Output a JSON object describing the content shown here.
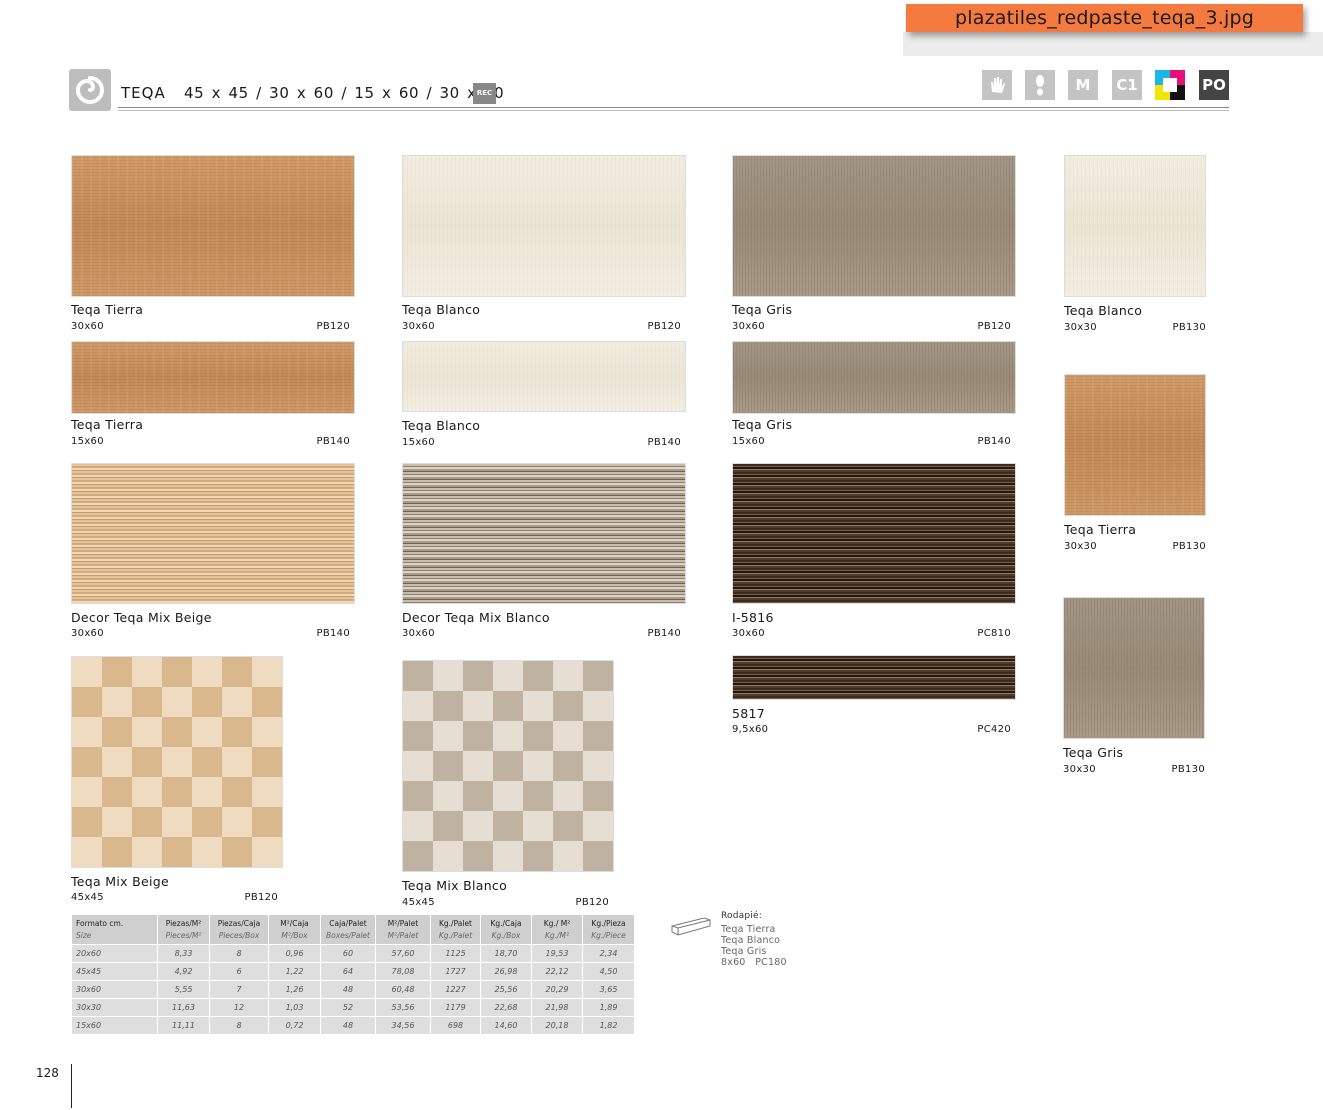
{
  "banner": {
    "filename": "plazatiles_redpaste_teqa_3.jpg"
  },
  "header": {
    "series": "TEQA",
    "formats": "45 x 45 / 30 x 60 / 15 x 60 / 30 x 30",
    "rec_badge": "REC",
    "icons": [
      {
        "name": "hand-icon",
        "label": ""
      },
      {
        "name": "foot-icon",
        "label": ""
      },
      {
        "name": "m-icon",
        "label": "M"
      },
      {
        "name": "c1-icon",
        "label": "C1"
      },
      {
        "name": "color-range-icon",
        "label": ""
      },
      {
        "name": "po-icon",
        "label": "PO"
      }
    ]
  },
  "products": [
    {
      "title": "Teqa Tierra",
      "size": "30x60",
      "code": "PB120"
    },
    {
      "title": "Teqa Blanco",
      "size": "30x60",
      "code": "PB120"
    },
    {
      "title": "Teqa Gris",
      "size": "30x60",
      "code": "PB120"
    },
    {
      "title": "Teqa Blanco",
      "size": "30x30",
      "code": "PB130"
    },
    {
      "title": "Teqa Tierra",
      "size": "15x60",
      "code": "PB140"
    },
    {
      "title": "Teqa Blanco",
      "size": "15x60",
      "code": "PB140"
    },
    {
      "title": "Teqa Gris",
      "size": "15x60",
      "code": "PB140"
    },
    {
      "title": "Teqa Tierra",
      "size": "30x30",
      "code": "PB130"
    },
    {
      "title": "Decor Teqa Mix Beige",
      "size": "30x60",
      "code": "PB140"
    },
    {
      "title": "Decor Teqa Mix Blanco",
      "size": "30x60",
      "code": "PB140"
    },
    {
      "title": "I-5816",
      "size": "30x60",
      "code": "PC810"
    },
    {
      "title": "Teqa Gris",
      "size": "30x30",
      "code": "PB130"
    },
    {
      "title": "Teqa Mix Beige",
      "size": "45x45",
      "code": "PB120"
    },
    {
      "title": "Teqa Mix Blanco",
      "size": "45x45",
      "code": "PB120"
    },
    {
      "title": "5817",
      "size": "9,5x60",
      "code": "PC420"
    }
  ],
  "table": {
    "headers": [
      {
        "es": "Formato cm.",
        "en": "Size"
      },
      {
        "es": "Piezas/M²",
        "en": "Pieces/M²"
      },
      {
        "es": "Piezas/Caja",
        "en": "Pieces/Box"
      },
      {
        "es": "M²/Caja",
        "en": "M²/Box"
      },
      {
        "es": "Caja/Palet",
        "en": "Boxes/Palet"
      },
      {
        "es": "M²/Palet",
        "en": "M²/Palet"
      },
      {
        "es": "Kg./Palet",
        "en": "Kg./Palet"
      },
      {
        "es": "Kg./Caja",
        "en": "Kg./Box"
      },
      {
        "es": "Kg./ M²",
        "en": "Kg./M²"
      },
      {
        "es": "Kg./Pieza",
        "en": "Kg./Piece"
      }
    ],
    "rows": [
      [
        "20x60",
        "8,33",
        "8",
        "0,96",
        "60",
        "57,60",
        "1125",
        "18,70",
        "19,53",
        "2,34"
      ],
      [
        "45x45",
        "4,92",
        "6",
        "1,22",
        "64",
        "78,08",
        "1727",
        "26,98",
        "22,12",
        "4,50"
      ],
      [
        "30x60",
        "5,55",
        "7",
        "1,26",
        "48",
        "60,48",
        "1227",
        "25,56",
        "20,29",
        "3,65"
      ],
      [
        "30x30",
        "11,63",
        "12",
        "1,03",
        "52",
        "53,56",
        "1179",
        "22,68",
        "21,98",
        "1,89"
      ],
      [
        "15x60",
        "11,11",
        "8",
        "0,72",
        "48",
        "34,56",
        "698",
        "14,60",
        "20,18",
        "1,82"
      ]
    ]
  },
  "rodapie": {
    "heading": "Rodapié:",
    "items": [
      "Teqa Tierra",
      "Teqa Blanco",
      "Teqa Gris"
    ],
    "size_code": "8x60   PC180"
  },
  "page_number": "128"
}
